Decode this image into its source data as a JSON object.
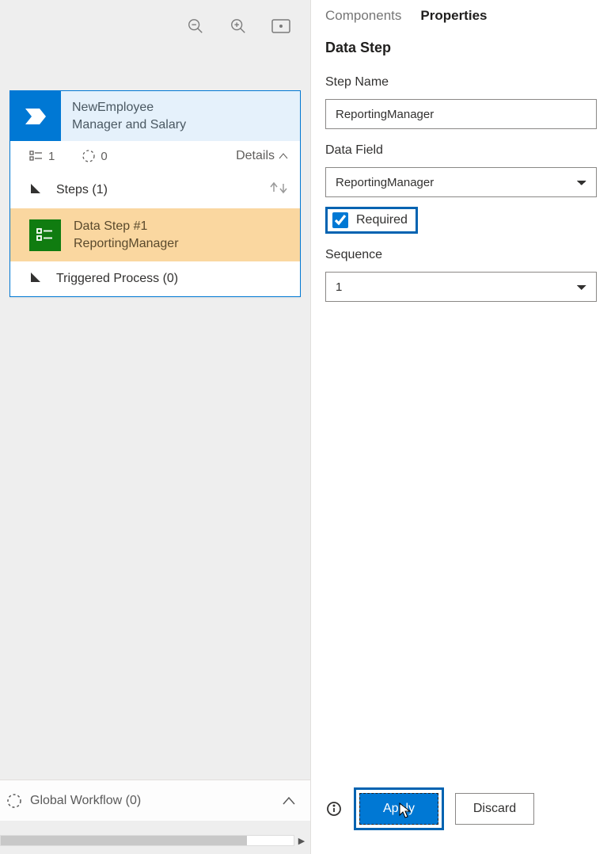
{
  "toolbar": {},
  "card": {
    "title1": "NewEmployee",
    "title2": "Manager and Salary",
    "meta_count_1": "1",
    "meta_count_2": "0",
    "details_label": "Details",
    "steps_label": "Steps (1)",
    "step1_title": "Data Step #1",
    "step1_sub": "ReportingManager",
    "triggered_label": "Triggered Process (0)"
  },
  "global_workflow": {
    "label": "Global Workflow (0)"
  },
  "tabs": {
    "components": "Components",
    "properties": "Properties"
  },
  "panel": {
    "heading": "Data Step",
    "step_name_label": "Step Name",
    "step_name_value": "ReportingManager",
    "data_field_label": "Data Field",
    "data_field_value": "ReportingManager",
    "required_label": "Required",
    "sequence_label": "Sequence",
    "sequence_value": "1"
  },
  "footer": {
    "apply": "Apply",
    "discard": "Discard"
  }
}
